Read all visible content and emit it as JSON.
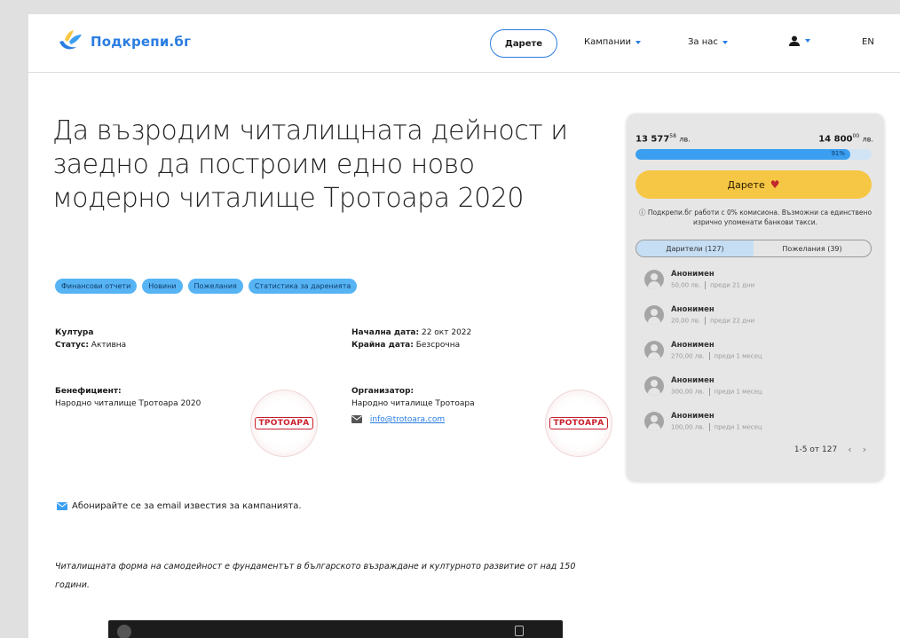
{
  "brand": {
    "name": "Подкрепи.бг",
    "accent": "#2a7de1"
  },
  "nav": {
    "donate_label": "Дарете",
    "campaigns_label": "Кампании",
    "about_label": "За нас",
    "lang_label": "EN"
  },
  "campaign": {
    "title": "Да възродим читалищната дейност и заедно да построим едно ново модерно читалище Тротоара 2020",
    "tags": [
      "Финансови отчети",
      "Новини",
      "Пожелания",
      "Статистика за даренията"
    ],
    "category": "Култура",
    "status_label": "Статус:",
    "status_value": "Активна",
    "start_label": "Начална дата:",
    "start_value": "22 окт 2022",
    "end_label": "Крайна дата:",
    "end_value": "Безсрочна",
    "beneficiary_label": "Бенефициент:",
    "beneficiary_value": "Народно читалище Тротоара 2020",
    "organizer_label": "Организатор:",
    "organizer_value": "Народно читалище Тротоара",
    "organizer_email": "info@trotoara.com",
    "org_logo_text": "ТРОТОАРА",
    "subscribe_text": "Абонирайте се за email известия за кампанията.",
    "description": "Читалищната форма на самодейност е фундаментът в българското възраждане и културното развитие от над 150 години."
  },
  "donation": {
    "raised_main": "13 577",
    "raised_cents": "58",
    "currency": "лв.",
    "goal_main": "14 800",
    "goal_cents": "00",
    "progress_percent": 91,
    "progress_label": "91%",
    "donate_label": "Дарете",
    "fee_note": "ⓘ Подкрепи.бг работи с 0% комисиона. Възможни са единствено изрично упоменати банкови такси.",
    "tab_donors": "Дарители (127)",
    "tab_wishes": "Пожелания (39)",
    "donors": [
      {
        "name": "Анонимен",
        "amount": "50,00 лв.",
        "time": "преди 21 дни"
      },
      {
        "name": "Анонимен",
        "amount": "20,00 лв.",
        "time": "преди 22 дни"
      },
      {
        "name": "Анонимен",
        "amount": "270,00 лв.",
        "time": "преди 1 месец"
      },
      {
        "name": "Анонимен",
        "amount": "300,00 лв.",
        "time": "преди 1 месец"
      },
      {
        "name": "Анонимен",
        "amount": "100,00 лв.",
        "time": "преди 1 месец"
      }
    ],
    "pager_text": "1-5 от 127",
    "prev_label": "‹",
    "next_label": "›"
  }
}
